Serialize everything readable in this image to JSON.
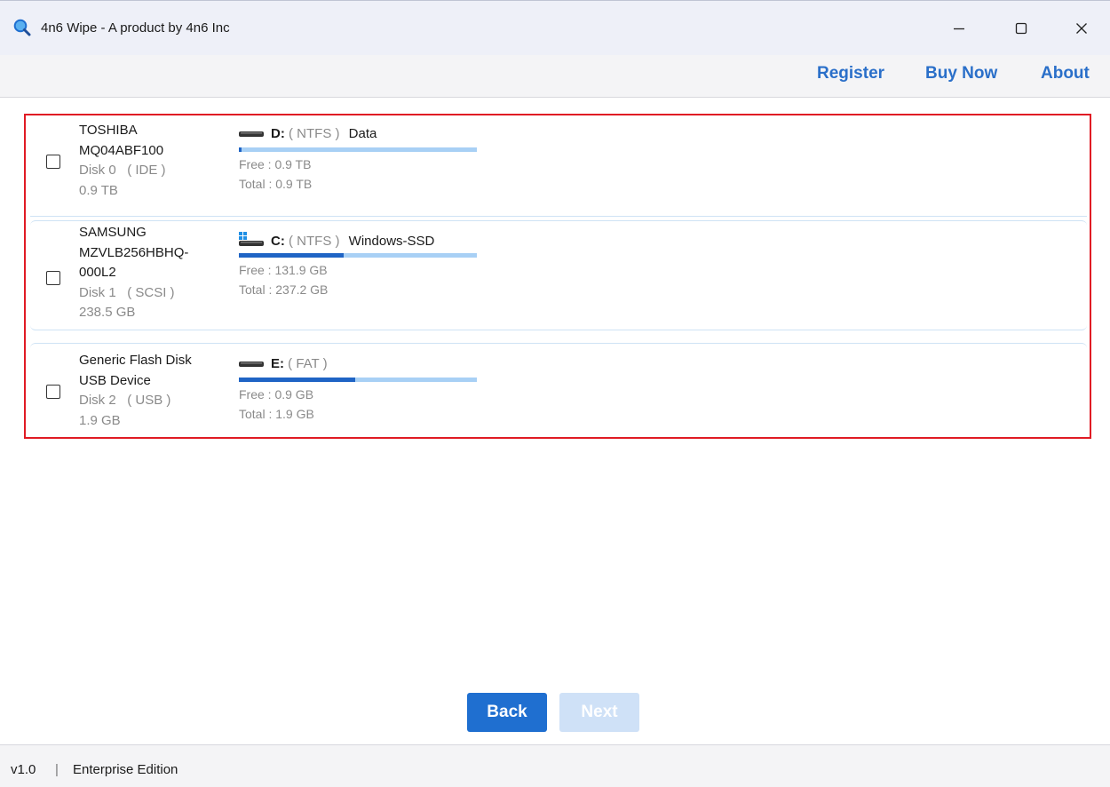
{
  "window": {
    "title": "4n6 Wipe - A product by 4n6 Inc",
    "icon": "search-icon",
    "controls": [
      "minimize-icon",
      "maximize-icon",
      "close-icon"
    ]
  },
  "menu": {
    "register": "Register",
    "buy_now": "Buy Now",
    "about": "About"
  },
  "disks": [
    {
      "name_lines": [
        "TOSHIBA",
        "MQ04ABF100"
      ],
      "disk_label": "Disk 0",
      "bus": "( IDE )",
      "size": "0.9 TB",
      "checked": false,
      "partition": {
        "icon": "drive-icon",
        "letter": "D:",
        "fs": "( NTFS )",
        "label": "Data",
        "free": "Free : 0.9 TB",
        "total": "Total : 0.9 TB",
        "used_fraction": 0.01
      }
    },
    {
      "name_lines": [
        "SAMSUNG",
        "MZVLB256HBHQ-",
        "000L2"
      ],
      "disk_label": "Disk 1",
      "bus": "( SCSI )",
      "size": "238.5 GB",
      "checked": false,
      "partition": {
        "icon": "windows-drive-icon",
        "letter": "C:",
        "fs": "( NTFS )",
        "label": "Windows-SSD",
        "free": "Free : 131.9 GB",
        "total": "Total : 237.2 GB",
        "used_fraction": 0.44
      }
    },
    {
      "name_lines": [
        "Generic Flash Disk",
        "USB Device"
      ],
      "disk_label": "Disk 2",
      "bus": "( USB )",
      "size": "1.9 GB",
      "checked": false,
      "partition": {
        "icon": "drive-icon",
        "letter": "E:",
        "fs": "( FAT )",
        "label": "",
        "free": "Free : 0.9 GB",
        "total": "Total : 1.9 GB",
        "used_fraction": 0.49
      }
    }
  ],
  "buttons": {
    "back": "Back",
    "next": "Next"
  },
  "status": {
    "version": "v1.0",
    "separator": "|",
    "edition": "Enterprise Edition"
  },
  "colors": {
    "accent": "#1f6fd0",
    "link": "#2a6fc9",
    "highlight_frame": "#e01b24",
    "bar_track": "#a8d0f5",
    "bar_fill": "#1f64c5",
    "next_disabled": "#cfe1f7"
  }
}
